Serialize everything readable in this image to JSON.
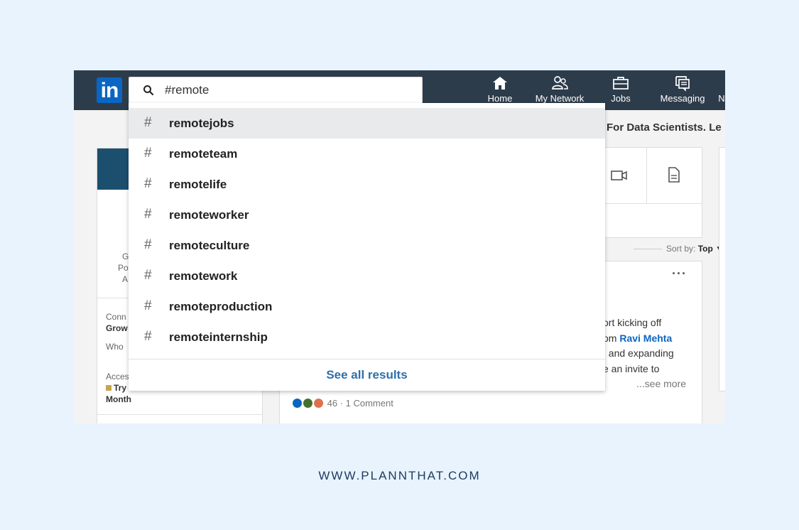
{
  "app": {
    "logo_text": "in",
    "brand_color": "#0a66c2",
    "topbar_color": "#2d3c4b"
  },
  "search": {
    "value": "#remote",
    "icon": "search-icon"
  },
  "nav": {
    "items": [
      {
        "label": "Home",
        "icon": "home-icon"
      },
      {
        "label": "My Network",
        "icon": "network-icon"
      },
      {
        "label": "Jobs",
        "icon": "briefcase-icon"
      },
      {
        "label": "Messaging",
        "icon": "messaging-icon"
      },
      {
        "label": "N",
        "icon": "notifications-icon"
      }
    ]
  },
  "dropdown": {
    "suggestions": [
      {
        "hash": "#",
        "term": "remotejobs"
      },
      {
        "hash": "#",
        "term": "remoteteam"
      },
      {
        "hash": "#",
        "term": "remotelife"
      },
      {
        "hash": "#",
        "term": "remoteworker"
      },
      {
        "hash": "#",
        "term": "remoteculture"
      },
      {
        "hash": "#",
        "term": "remotework"
      },
      {
        "hash": "#",
        "term": "remoteproduction"
      },
      {
        "hash": "#",
        "term": "remoteinternship"
      }
    ],
    "see_all": "See all results"
  },
  "background": {
    "promo": "For Data Scientists. Le",
    "sort_prefix": "Sort by:",
    "sort_value": "Top",
    "post_lines": [
      "ort kicking off",
      "om",
      "Ravi Mehta",
      ", and expanding",
      "e an invite to",
      "...see more"
    ],
    "reactions": "46 · 1 Comment",
    "profile_fragments": [
      "G",
      "Po",
      "A",
      "Conn",
      "Grow",
      "Who",
      "Acces",
      "Try",
      "Month"
    ]
  },
  "footer": {
    "text": "WWW.PLANNTHAT.COM"
  }
}
